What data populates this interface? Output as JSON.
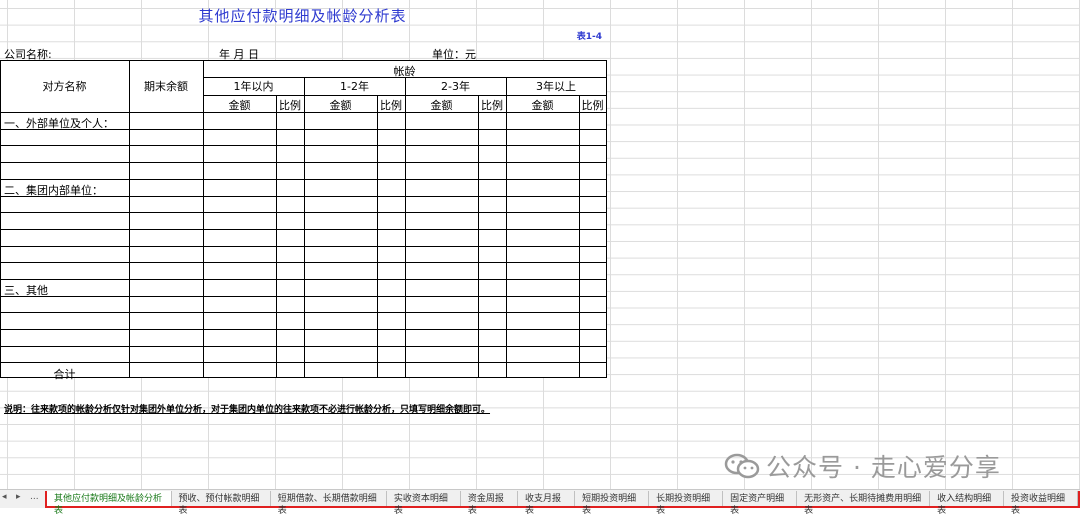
{
  "sheet": {
    "title": "其他应付款明细及帐龄分析表",
    "table_no": "表1-4",
    "company_label": "公司名称:",
    "date_label": "年    月    日",
    "unit_label": "单位：元"
  },
  "table": {
    "col_name": "对方名称",
    "col_balance": "期末余额",
    "col_aging": "帐龄",
    "aging_periods": [
      "1年以内",
      "1-2年",
      "2-3年",
      "3年以上"
    ],
    "sub_amount": "金额",
    "sub_ratio": "比例",
    "sections": [
      "一、外部单位及个人：",
      "二、集团内部单位：",
      "三、其他"
    ],
    "total_label": "合计"
  },
  "note": "说明：往来款项的帐龄分析仅针对集团外单位分析，对于集团内单位的往来款项不必进行帐龄分析，只填写明细余额即可。",
  "watermark": "公众号 · 走心爱分享",
  "tabbar": {
    "nav_prev": "◂",
    "nav_next": "▸",
    "nav_more": "...",
    "tabs": [
      "其他应付款明细及帐龄分析表",
      "预收、预付帐款明细表",
      "短期借款、长期借款明细表",
      "实收资本明细表",
      "资金周报表",
      "收支月报表",
      "短期投资明细表",
      "长期投资明细表",
      "固定资产明细表",
      "无形资产、长期待摊费用明细表",
      "收入结构明细表",
      "投资收益明细表"
    ],
    "active_index": 0
  }
}
